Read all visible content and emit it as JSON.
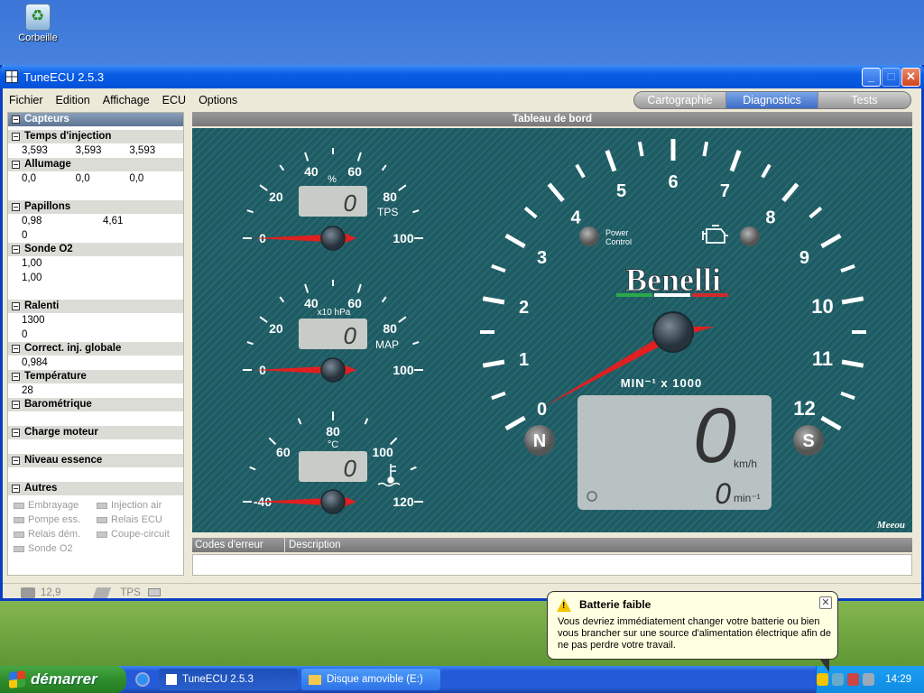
{
  "desktop": {
    "recycle_label": "Corbeille"
  },
  "window": {
    "title": "TuneECU 2.5.3"
  },
  "menu": [
    "Fichier",
    "Edition",
    "Affichage",
    "ECU",
    "Options"
  ],
  "tabs": [
    {
      "label": "Cartographie",
      "active": false
    },
    {
      "label": "Diagnostics",
      "active": true
    },
    {
      "label": "Tests",
      "active": false
    }
  ],
  "sensors": {
    "header": "Capteurs",
    "injection": {
      "title": "Temps d'injection",
      "values": [
        "3,593",
        "3,593",
        "3,593"
      ]
    },
    "ignition": {
      "title": "Allumage",
      "values": [
        "0,0",
        "0,0",
        "0,0"
      ]
    },
    "throttle": {
      "title": "Papillons",
      "values": [
        "0,98",
        "4,61"
      ],
      "extra": "0"
    },
    "o2": {
      "title": "Sonde O2",
      "values": [
        "1,00",
        "1,00"
      ]
    },
    "idle": {
      "title": "Ralenti",
      "values": [
        "1300",
        "0"
      ]
    },
    "global_corr": {
      "title": "Correct. inj. globale",
      "value": "0,984"
    },
    "temperature": {
      "title": "Température",
      "value": "28"
    },
    "barometric": {
      "title": "Barométrique"
    },
    "load": {
      "title": "Charge moteur"
    },
    "fuel": {
      "title": "Niveau essence"
    },
    "other": {
      "title": "Autres",
      "items": [
        "Embrayage",
        "Injection air",
        "Pompe ess.",
        "Relais ECU",
        "Relais dém.",
        "Coupe-circuit",
        "Sonde O2"
      ]
    }
  },
  "dashboard": {
    "title": "Tableau de bord",
    "tps": {
      "labels": [
        "0",
        "20",
        "40",
        "60",
        "80",
        "100"
      ],
      "unit": "%",
      "name": "TPS",
      "value": "0"
    },
    "map": {
      "labels": [
        "0",
        "20",
        "40",
        "60",
        "80",
        "100"
      ],
      "unit": "x10 hPa",
      "name": "MAP",
      "value": "0"
    },
    "temp": {
      "labels": [
        "-40",
        "60",
        "80",
        "100",
        "120"
      ],
      "unit": "°C",
      "value": "0"
    },
    "tach": {
      "labels": [
        "0",
        "1",
        "2",
        "3",
        "4",
        "5",
        "6",
        "7",
        "8",
        "9",
        "10",
        "11",
        "12"
      ],
      "unit": "MIN⁻¹ x 1000"
    },
    "power_label": "Power Control",
    "brand": "Benelli",
    "neutral": "N",
    "service": "S",
    "speed": {
      "value": "0",
      "unit": "km/h"
    },
    "rpm": {
      "value": "0",
      "unit": "min⁻¹"
    },
    "signature": "Meeou"
  },
  "errors": {
    "col1": "Codes d'erreur",
    "col2": "Description"
  },
  "status": {
    "voltage": "12,9",
    "tps": "TPS"
  },
  "taskbar": {
    "start": "démarrer",
    "items": [
      "TuneECU 2.5.3",
      "Disque amovible (E:)"
    ],
    "time": "14:29"
  },
  "balloon": {
    "title": "Batterie faible",
    "text": "Vous devriez immédiatement changer votre batterie ou bien vous brancher sur une source d'alimentation électrique afin de ne pas perdre votre travail."
  }
}
